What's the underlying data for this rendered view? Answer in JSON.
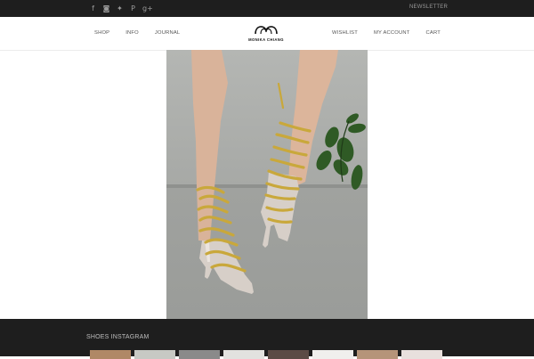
{
  "topbar": {
    "social_icons": [
      {
        "name": "facebook-icon",
        "glyph": "f"
      },
      {
        "name": "instagram-icon",
        "glyph": "◙"
      },
      {
        "name": "twitter-icon",
        "glyph": "✦"
      },
      {
        "name": "pinterest-icon",
        "glyph": "P"
      },
      {
        "name": "google-plus-icon",
        "glyph": "g+"
      }
    ],
    "newsletter_label": "NEWSLETTER"
  },
  "nav": {
    "left": [
      "SHOP",
      "INFO",
      "JOURNAL"
    ],
    "right": [
      "WISHLIST",
      "MY ACCOUNT",
      "CART"
    ]
  },
  "logo": {
    "text": "MONIKA CHIANG"
  },
  "hero": {
    "alt": "Legs wearing lace-up gold strappy high heel sandals against a concrete wall"
  },
  "footer": {
    "instagram_title": "SHOES INSTAGRAM",
    "thumb_colors": [
      "#b08866",
      "#c7c9c4",
      "#8a8a8a",
      "#e2e2df",
      "#5b4b45",
      "#f0efed",
      "#b59479",
      "#e8e0dd"
    ]
  },
  "colors": {
    "topbar": "#1e1e1e",
    "muted_text": "#9a9a9a",
    "footer": "#1e1e1e"
  }
}
